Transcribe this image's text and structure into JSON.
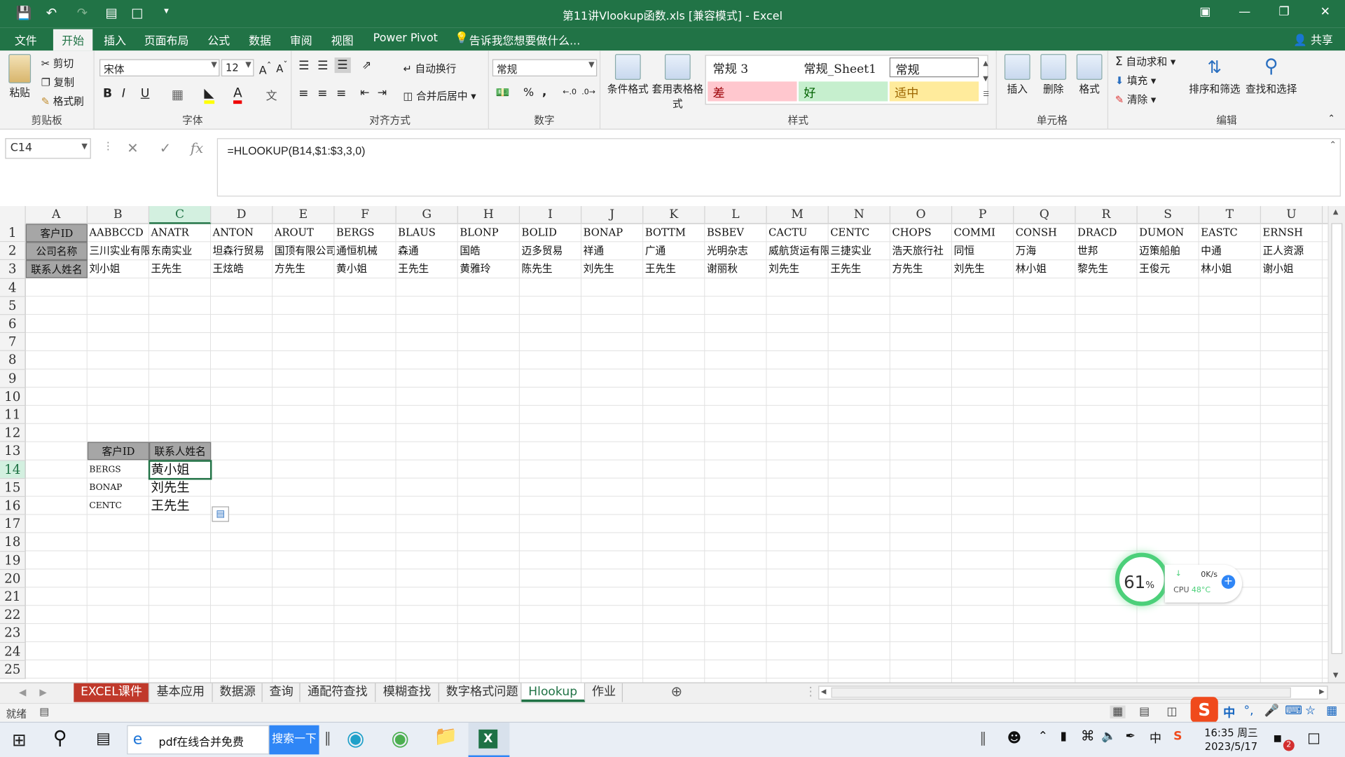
{
  "window": {
    "title": "第11讲Vlookup函数.xls  [兼容模式] - Excel"
  },
  "ribbon_tabs": [
    "文件",
    "开始",
    "插入",
    "页面布局",
    "公式",
    "数据",
    "审阅",
    "视图",
    "Power Pivot"
  ],
  "ribbon_active": "开始",
  "tell_me": "告诉我您想要做什么...",
  "share": "共享",
  "clipboard": {
    "paste": "粘贴",
    "cut": "剪切",
    "copy": "复制",
    "painter": "格式刷",
    "label": "剪贴板"
  },
  "font": {
    "name": "宋体",
    "size": "12",
    "label": "字体",
    "bold": "B",
    "italic": "I",
    "underline": "U"
  },
  "alignment": {
    "wrap": "自动换行",
    "merge": "合并后居中",
    "label": "对齐方式"
  },
  "number": {
    "format": "常规",
    "percent": "%",
    "comma": ",",
    "label": "数字"
  },
  "styles": {
    "cond": "条件格式",
    "table": "套用表格格式",
    "normal3": "常规 3",
    "normal_sheet1": "常规_Sheet1",
    "normal": "常规",
    "bad": "差",
    "good": "好",
    "neutral": "适中",
    "label": "样式",
    "colors": {
      "bad": "#ffc7ce",
      "good": "#c6efce",
      "neutral": "#ffeb9c"
    }
  },
  "cells_group": {
    "insert": "插入",
    "delete": "删除",
    "format": "格式",
    "label": "单元格"
  },
  "editing": {
    "autosum": "自动求和",
    "fill": "填充",
    "clear": "清除",
    "sort": "排序和筛选",
    "find": "查找和选择",
    "label": "编辑"
  },
  "namebox": "C14",
  "formula": "=HLOOKUP(B14,$1:$3,3,0)",
  "columns": [
    "A",
    "B",
    "C",
    "D",
    "E",
    "F",
    "G",
    "H",
    "I",
    "J",
    "K",
    "L",
    "M",
    "N",
    "O",
    "P",
    "Q",
    "R",
    "S",
    "T",
    "U"
  ],
  "selected_column": "C",
  "rows": [
    "1",
    "2",
    "3",
    "4",
    "5",
    "6",
    "7",
    "8",
    "9",
    "10",
    "11",
    "12",
    "13",
    "14",
    "15",
    "16",
    "17",
    "18",
    "19",
    "20",
    "21",
    "22",
    "23",
    "24",
    "25"
  ],
  "selected_row": "14",
  "row1": [
    "客户ID",
    "AABBCCD",
    "ANATR",
    "ANTON",
    "AROUT",
    "BERGS",
    "BLAUS",
    "BLONP",
    "BOLID",
    "BONAP",
    "BOTTM",
    "BSBEV",
    "CACTU",
    "CENTC",
    "CHOPS",
    "COMMI",
    "CONSH",
    "DRACD",
    "DUMON",
    "EASTC",
    "ERNSH"
  ],
  "row2": [
    "公司名称",
    "三川实业有限",
    "东南实业",
    "坦森行贸易",
    "国顶有限公司",
    "通恒机械",
    "森通",
    "国皓",
    "迈多贸易",
    "祥通",
    "广通",
    "光明杂志",
    "威航货运有限",
    "三捷实业",
    "浩天旅行社",
    "同恒",
    "万海",
    "世邦",
    "迈策船舶",
    "中通",
    "正人资源"
  ],
  "row3": [
    "联系人姓名",
    "刘小姐",
    "王先生",
    "王炫皓",
    "方先生",
    "黄小姐",
    "王先生",
    "黄雅玲",
    "陈先生",
    "刘先生",
    "王先生",
    "谢丽秋",
    "刘先生",
    "王先生",
    "方先生",
    "刘先生",
    "林小姐",
    "黎先生",
    "王俊元",
    "林小姐",
    "谢小姐"
  ],
  "lookup_table": {
    "headers": [
      "客户ID",
      "联系人姓名"
    ],
    "rows": [
      [
        "BERGS",
        "黄小姐"
      ],
      [
        "BONAP",
        "刘先生"
      ],
      [
        "CENTC",
        "王先生"
      ]
    ]
  },
  "sheet_tabs": [
    "EXCEL课件",
    "基本应用",
    "数据源",
    "查询",
    "通配符查找",
    "模糊查找",
    "数字格式问题",
    "Hlookup",
    "作业"
  ],
  "active_sheet": "Hlookup",
  "status": "就绪",
  "monitor": {
    "percent": "61",
    "percent_unit": "%",
    "net": "0K/s",
    "cpu_label": "CPU",
    "cpu_temp": "48°C"
  },
  "taskbar": {
    "search_text": "pdf在线合并免费",
    "search_btn": "搜索一下",
    "time": "16:35 周三",
    "date": "2023/5/17",
    "ime": "中",
    "badge": "2"
  }
}
